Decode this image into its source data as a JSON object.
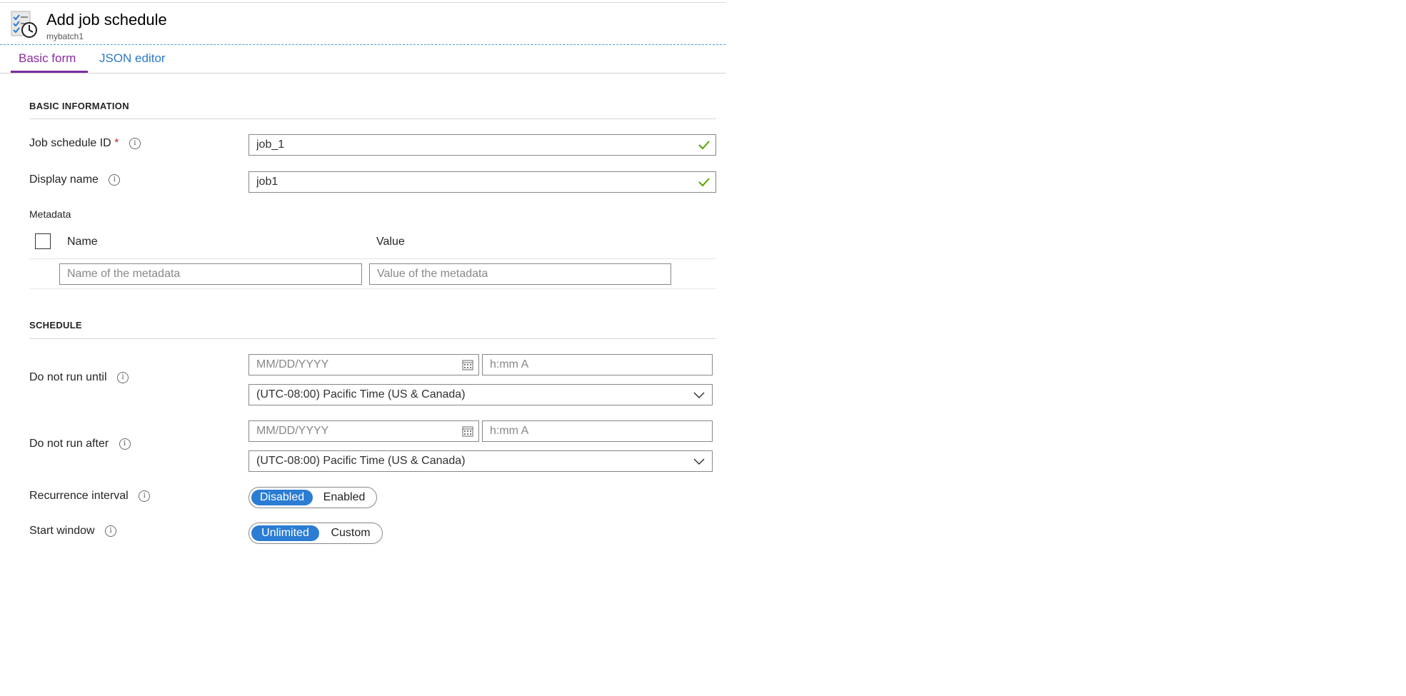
{
  "header": {
    "title": "Add job schedule",
    "subtitle": "mybatch1",
    "icon": "schedule-icon"
  },
  "tabs": [
    {
      "label": "Basic form",
      "active": true
    },
    {
      "label": "JSON editor",
      "active": false
    }
  ],
  "basic_information": {
    "section_title": "BASIC INFORMATION",
    "job_schedule_id": {
      "label": "Job schedule ID",
      "required_mark": "*",
      "value": "job_1"
    },
    "display_name": {
      "label": "Display name",
      "value": "job1"
    }
  },
  "metadata": {
    "label": "Metadata",
    "columns": {
      "name": "Name",
      "value": "Value"
    },
    "name_placeholder": "Name of the metadata",
    "value_placeholder": "Value of the metadata"
  },
  "schedule": {
    "section_title": "SCHEDULE",
    "do_not_run_until": {
      "label": "Do not run until",
      "date_placeholder": "MM/DD/YYYY",
      "time_placeholder": "h:mm A",
      "timezone": "(UTC-08:00) Pacific Time (US & Canada)"
    },
    "do_not_run_after": {
      "label": "Do not run after",
      "date_placeholder": "MM/DD/YYYY",
      "time_placeholder": "h:mm A",
      "timezone": "(UTC-08:00) Pacific Time (US & Canada)"
    },
    "recurrence_interval": {
      "label": "Recurrence interval",
      "options": [
        "Disabled",
        "Enabled"
      ],
      "selected": "Disabled"
    },
    "start_window": {
      "label": "Start window",
      "options": [
        "Unlimited",
        "Custom"
      ],
      "selected": "Unlimited"
    }
  },
  "colors": {
    "accent_tab": "#7b2d9e",
    "link": "#2d79c7",
    "toggle_active": "#2b7cd3",
    "valid_check": "#57a300",
    "required": "#c4262e"
  }
}
